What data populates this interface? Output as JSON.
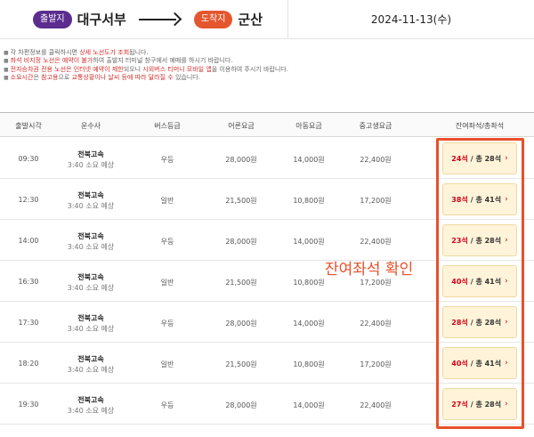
{
  "route": {
    "departure_badge": "출발지",
    "departure_city": "대구서부",
    "arrival_badge": "도착지",
    "arrival_city": "군산",
    "date": "2024-11-13(수)"
  },
  "notices": [
    {
      "parts": [
        {
          "t": "각 차편정보를 클릭하시면 ",
          "hl": false
        },
        {
          "t": "상세 노선도가 조회",
          "hl": true
        },
        {
          "t": "됩니다.",
          "hl": false
        }
      ]
    },
    {
      "parts": [
        {
          "t": "좌석 비지정 노선은 예약이 불가",
          "hl": true
        },
        {
          "t": "하여 출발지 터미널 창구에서 예매를 하시기 바랍니다.",
          "hl": false
        }
      ]
    },
    {
      "parts": [
        {
          "t": "전자승차권 전용 노선은 인터넷 예약이 제한",
          "hl": true
        },
        {
          "t": "되오니 ",
          "hl": false
        },
        {
          "t": "시외버스 티머니 모바일 앱",
          "hl": true
        },
        {
          "t": "을 이용하여 주시기 바랍니다.",
          "hl": false
        }
      ]
    },
    {
      "parts": [
        {
          "t": "소요시간",
          "hl": true
        },
        {
          "t": "은 ",
          "hl": false
        },
        {
          "t": "참고용",
          "hl": true
        },
        {
          "t": "으로 ",
          "hl": false
        },
        {
          "t": "교통상황이나 날씨 등에 따라 달라질 수",
          "hl": true
        },
        {
          "t": " 있습니다.",
          "hl": false
        }
      ]
    }
  ],
  "table": {
    "headers": [
      "출발시각",
      "운수사",
      "버스등급",
      "어른요금",
      "아동요금",
      "중고생요금",
      "잔여좌석/총좌석"
    ],
    "rows": [
      {
        "time": "09:30",
        "operator": "전북고속",
        "duration": "3:40 소요 예상",
        "grade": "우등",
        "adult": "28,000원",
        "child": "14,000원",
        "student": "22,400원",
        "remaining": "24석",
        "total": "/ 총 28석"
      },
      {
        "time": "12:30",
        "operator": "전북고속",
        "duration": "3:40 소요 예상",
        "grade": "일반",
        "adult": "21,500원",
        "child": "10,800원",
        "student": "17,200원",
        "remaining": "38석",
        "total": "/ 총 41석"
      },
      {
        "time": "14:00",
        "operator": "전북고속",
        "duration": "3:40 소요 예상",
        "grade": "우등",
        "adult": "28,000원",
        "child": "14,000원",
        "student": "22,400원",
        "remaining": "23석",
        "total": "/ 총 28석"
      },
      {
        "time": "16:30",
        "operator": "전북고속",
        "duration": "3:40 소요 예상",
        "grade": "일반",
        "adult": "21,500원",
        "child": "10,800원",
        "student": "17,200원",
        "remaining": "40석",
        "total": "/ 총 41석"
      },
      {
        "time": "17:30",
        "operator": "전북고속",
        "duration": "3:40 소요 예상",
        "grade": "우등",
        "adult": "28,000원",
        "child": "14,000원",
        "student": "22,400원",
        "remaining": "28석",
        "total": "/ 총 28석"
      },
      {
        "time": "18:20",
        "operator": "전북고속",
        "duration": "3:40 소요 예상",
        "grade": "일반",
        "adult": "21,500원",
        "child": "10,800원",
        "student": "17,200원",
        "remaining": "40석",
        "total": "/ 총 41석"
      },
      {
        "time": "19:30",
        "operator": "전북고속",
        "duration": "3:40 소요 예상",
        "grade": "우등",
        "adult": "28,000원",
        "child": "14,000원",
        "student": "22,400원",
        "remaining": "27석",
        "total": "/ 총 28석"
      }
    ]
  },
  "annotation": "잔여좌석 확인",
  "colors": {
    "accent_red": "#d0021b",
    "departure_purple": "#5b2d8e",
    "arrival_orange": "#e4572e",
    "annotation_orange": "#e8502a",
    "seat_button_bg": "#fff4d9"
  }
}
